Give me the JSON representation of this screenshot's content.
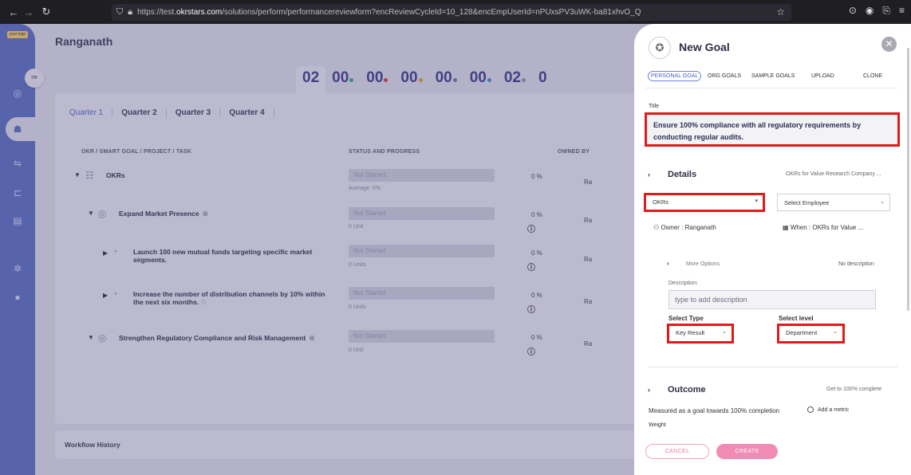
{
  "browser": {
    "back": "←",
    "forward": "→",
    "reload": "↻",
    "url_prefix": "https://test.",
    "url_host": "okrstars.com",
    "url_rest": "/solutions/perform/performancereviewform?encReviewCycleId=10_128&encEmpUserId=nPUxsPV3uWK-ba81xhvO_Q"
  },
  "sidebar": {
    "logo_text": "your logo"
  },
  "page": {
    "title": "Ranganath"
  },
  "timer": {
    "segments": [
      {
        "value": "02",
        "dot": ""
      },
      {
        "value": "00",
        "dot": "#2fb27a"
      },
      {
        "value": "00",
        "dot": "#e03c3c"
      },
      {
        "value": "00",
        "dot": "#f0a030"
      },
      {
        "value": "00",
        "dot": "#7a7a9a"
      },
      {
        "value": "00",
        "dot": "#4a90e2"
      },
      {
        "value": "02",
        "dot": "#9a9aa8"
      },
      {
        "value": "0",
        "dot": ""
      }
    ]
  },
  "quarters": [
    "Quarter 1",
    "Quarter 2",
    "Quarter 3",
    "Quarter 4"
  ],
  "table": {
    "col_goal": "OKR / SMART GOAL / PROJECT / TASK",
    "col_status": "STATUS AND PROGRESS",
    "col_owner": "OWNED BY",
    "rows": [
      {
        "title": "OKRs",
        "status": "Not Started",
        "sub": "Average: 0%",
        "pct": "0 %",
        "owner": "Ra"
      },
      {
        "title": "Expand Market Presence",
        "status": "Not Started",
        "sub": "0 Unit",
        "pct": "0 %",
        "owner": "Ra"
      },
      {
        "title": "Launch 100 new mutual funds targeting specific market segments.",
        "status": "Not Started",
        "sub": "0 Units",
        "pct": "0 %",
        "owner": "Ra"
      },
      {
        "title": "Increase the number of distribution channels by 10% within the next six months.",
        "status": "Not Started",
        "sub": "0 Units",
        "pct": "0 %",
        "owner": "Ra"
      },
      {
        "title": "Strengthen Regulatory Compliance and Risk Management",
        "status": "Not Started",
        "sub": "0 Unit",
        "pct": "0 %",
        "owner": "Ra"
      }
    ]
  },
  "workflow": {
    "label": "Workflow History"
  },
  "drawer": {
    "title": "New Goal",
    "tabs": [
      "PERSONAL GOAL",
      "ORG GOALS",
      "SAMPLE GOALS",
      "UPLOAD",
      "CLONE"
    ],
    "title_label": "Title",
    "title_value": "Ensure 100% compliance with all regulatory requirements by conducting regular audits.",
    "details": {
      "header": "Details",
      "meta": "OKRs for Value Research Company ...",
      "goal_type": "OKRs",
      "employee_placeholder": "Select Employee",
      "owner": "Owner : Ranganath",
      "when": "When : OKRs for Value ...",
      "more_options": "More Options",
      "no_description": "No description",
      "description_label": "Description:",
      "description_placeholder": "type to add description",
      "select_type_label": "Select Type",
      "select_type_value": "Key Result",
      "select_level_label": "Select level",
      "select_level_value": "Department"
    },
    "outcome": {
      "header": "Outcome",
      "meta": "Get to 100% complete",
      "measured": "Measured as a goal towards 100% completion",
      "add_metric": "Add a metric",
      "weight": "Weight"
    },
    "cancel": "CANCEL",
    "create": "CREATE"
  }
}
